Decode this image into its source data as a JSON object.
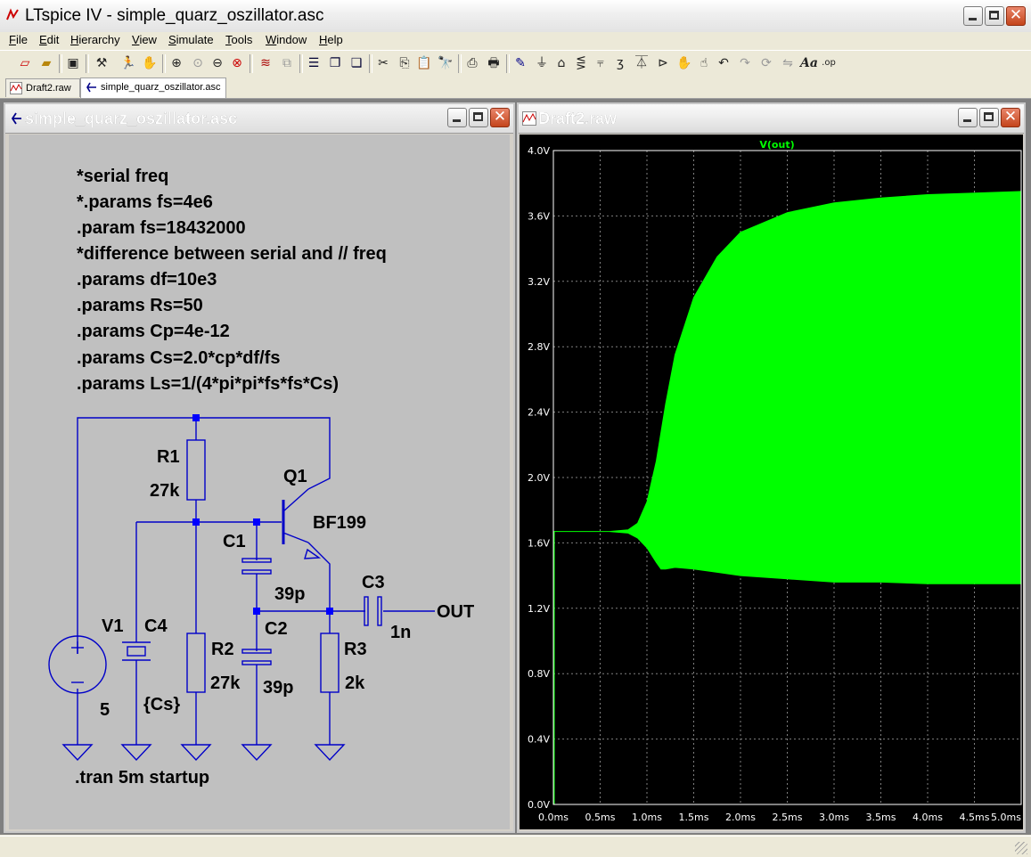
{
  "window": {
    "title": "LTspice IV - simple_quarz_oszillator.asc"
  },
  "menu": [
    {
      "label": "File",
      "u": "F",
      "rest": "ile"
    },
    {
      "label": "Edit",
      "u": "E",
      "rest": "dit"
    },
    {
      "label": "Hierarchy",
      "u": "H",
      "rest": "ierarchy"
    },
    {
      "label": "View",
      "u": "V",
      "rest": "iew"
    },
    {
      "label": "Simulate",
      "u": "S",
      "rest": "imulate"
    },
    {
      "label": "Tools",
      "u": "T",
      "rest": "ools"
    },
    {
      "label": "Window",
      "u": "W",
      "rest": "indow"
    },
    {
      "label": "Help",
      "u": "H",
      "rest": "elp"
    }
  ],
  "toolbar": {
    "icons": [
      "new-schematic-icon",
      "open-icon",
      "save-icon",
      "control-panel-icon",
      "run-icon",
      "halt-icon",
      "zoom-in-icon",
      "zoom-full-icon",
      "zoom-out-icon",
      "zoom-cancel-icon",
      "autorange-icon",
      "mark-text-icon",
      "tile-horizontal-icon",
      "cascade-icon",
      "close-all-icon",
      "cut-icon",
      "copy-icon",
      "paste-icon",
      "find-icon",
      "print-setup-icon",
      "print-icon",
      "wire-icon",
      "ground-icon",
      "label-net-icon",
      "resistor-icon",
      "capacitor-icon",
      "inductor-icon",
      "diode-icon",
      "component-icon",
      "move-icon",
      "drag-icon",
      "undo-icon",
      "redo-icon",
      "rotate-icon",
      "mirror-icon",
      "text-icon",
      "spice-directive-icon"
    ]
  },
  "tabs": [
    {
      "label": "Draft2.raw",
      "active": false
    },
    {
      "label": "simple_quarz_oszillator.asc",
      "active": true
    }
  ],
  "schematic": {
    "title": "simple_quarz_oszillator.asc",
    "directives": [
      "*serial freq",
      "*.params fs=4e6",
      ".param fs=18432000",
      "*difference between serial and // freq",
      ".params df=10e3",
      ".params Rs=50",
      ".params Cp=4e-12",
      ".params Cs=2.0*cp*df/fs",
      ".params Ls=1/(4*pi*pi*fs*fs*Cs)"
    ],
    "tran": ".tran 5m startup",
    "labels": {
      "r1": "R1",
      "r1v": "27k",
      "q1": "Q1",
      "q1v": "BF199",
      "c1": "C1",
      "c1v": "39p",
      "c3": "C3",
      "c3v": "1n",
      "out": "OUT",
      "v1": "V1",
      "v1v": "5",
      "c4": "C4",
      "c4v": "{Cs}",
      "r2": "R2",
      "r2v": "27k",
      "c2": "C2",
      "c2v": "39p",
      "r3": "R3",
      "r3v": "2k"
    },
    "colors": {
      "background": "#c0c0c0",
      "wire": "#0000c8",
      "junction": "#0000ff"
    }
  },
  "waveform": {
    "title": "Draft2.raw",
    "trace_label": "V(out)",
    "colors": {
      "trace": "#00ff00",
      "background": "#000000"
    }
  },
  "chart_data": {
    "type": "area",
    "title": "V(out)",
    "xlabel": "",
    "ylabel": "",
    "xlim": [
      0.0,
      5.0
    ],
    "ylim": [
      0.0,
      4.0
    ],
    "x_ticks": [
      "0.0ms",
      "0.5ms",
      "1.0ms",
      "1.5ms",
      "2.0ms",
      "2.5ms",
      "3.0ms",
      "3.5ms",
      "4.0ms",
      "4.5ms",
      "5.0ms"
    ],
    "y_ticks": [
      "0.0V",
      "0.4V",
      "0.8V",
      "1.2V",
      "1.6V",
      "2.0V",
      "2.4V",
      "2.8V",
      "3.2V",
      "3.6V",
      "4.0V"
    ],
    "grid": true,
    "series": [
      {
        "name": "V(out)",
        "envelope": "upper",
        "x": [
          0.0,
          0.05,
          0.6,
          0.8,
          0.9,
          1.0,
          1.1,
          1.2,
          1.3,
          1.5,
          1.75,
          2.0,
          2.5,
          3.0,
          3.5,
          4.0,
          4.5,
          5.0
        ],
        "values": [
          1.67,
          1.67,
          1.67,
          1.68,
          1.72,
          1.85,
          2.1,
          2.45,
          2.75,
          3.1,
          3.35,
          3.5,
          3.62,
          3.68,
          3.71,
          3.73,
          3.74,
          3.75
        ]
      },
      {
        "name": "V(out)",
        "envelope": "lower",
        "x": [
          0.0,
          0.05,
          0.6,
          0.8,
          0.9,
          1.0,
          1.1,
          1.15,
          1.2,
          1.3,
          1.5,
          1.75,
          2.0,
          2.5,
          3.0,
          3.5,
          4.0,
          4.5,
          5.0
        ],
        "values": [
          1.67,
          1.67,
          1.67,
          1.66,
          1.63,
          1.57,
          1.48,
          1.44,
          1.44,
          1.45,
          1.44,
          1.42,
          1.4,
          1.38,
          1.36,
          1.36,
          1.35,
          1.35,
          1.35
        ]
      }
    ]
  }
}
